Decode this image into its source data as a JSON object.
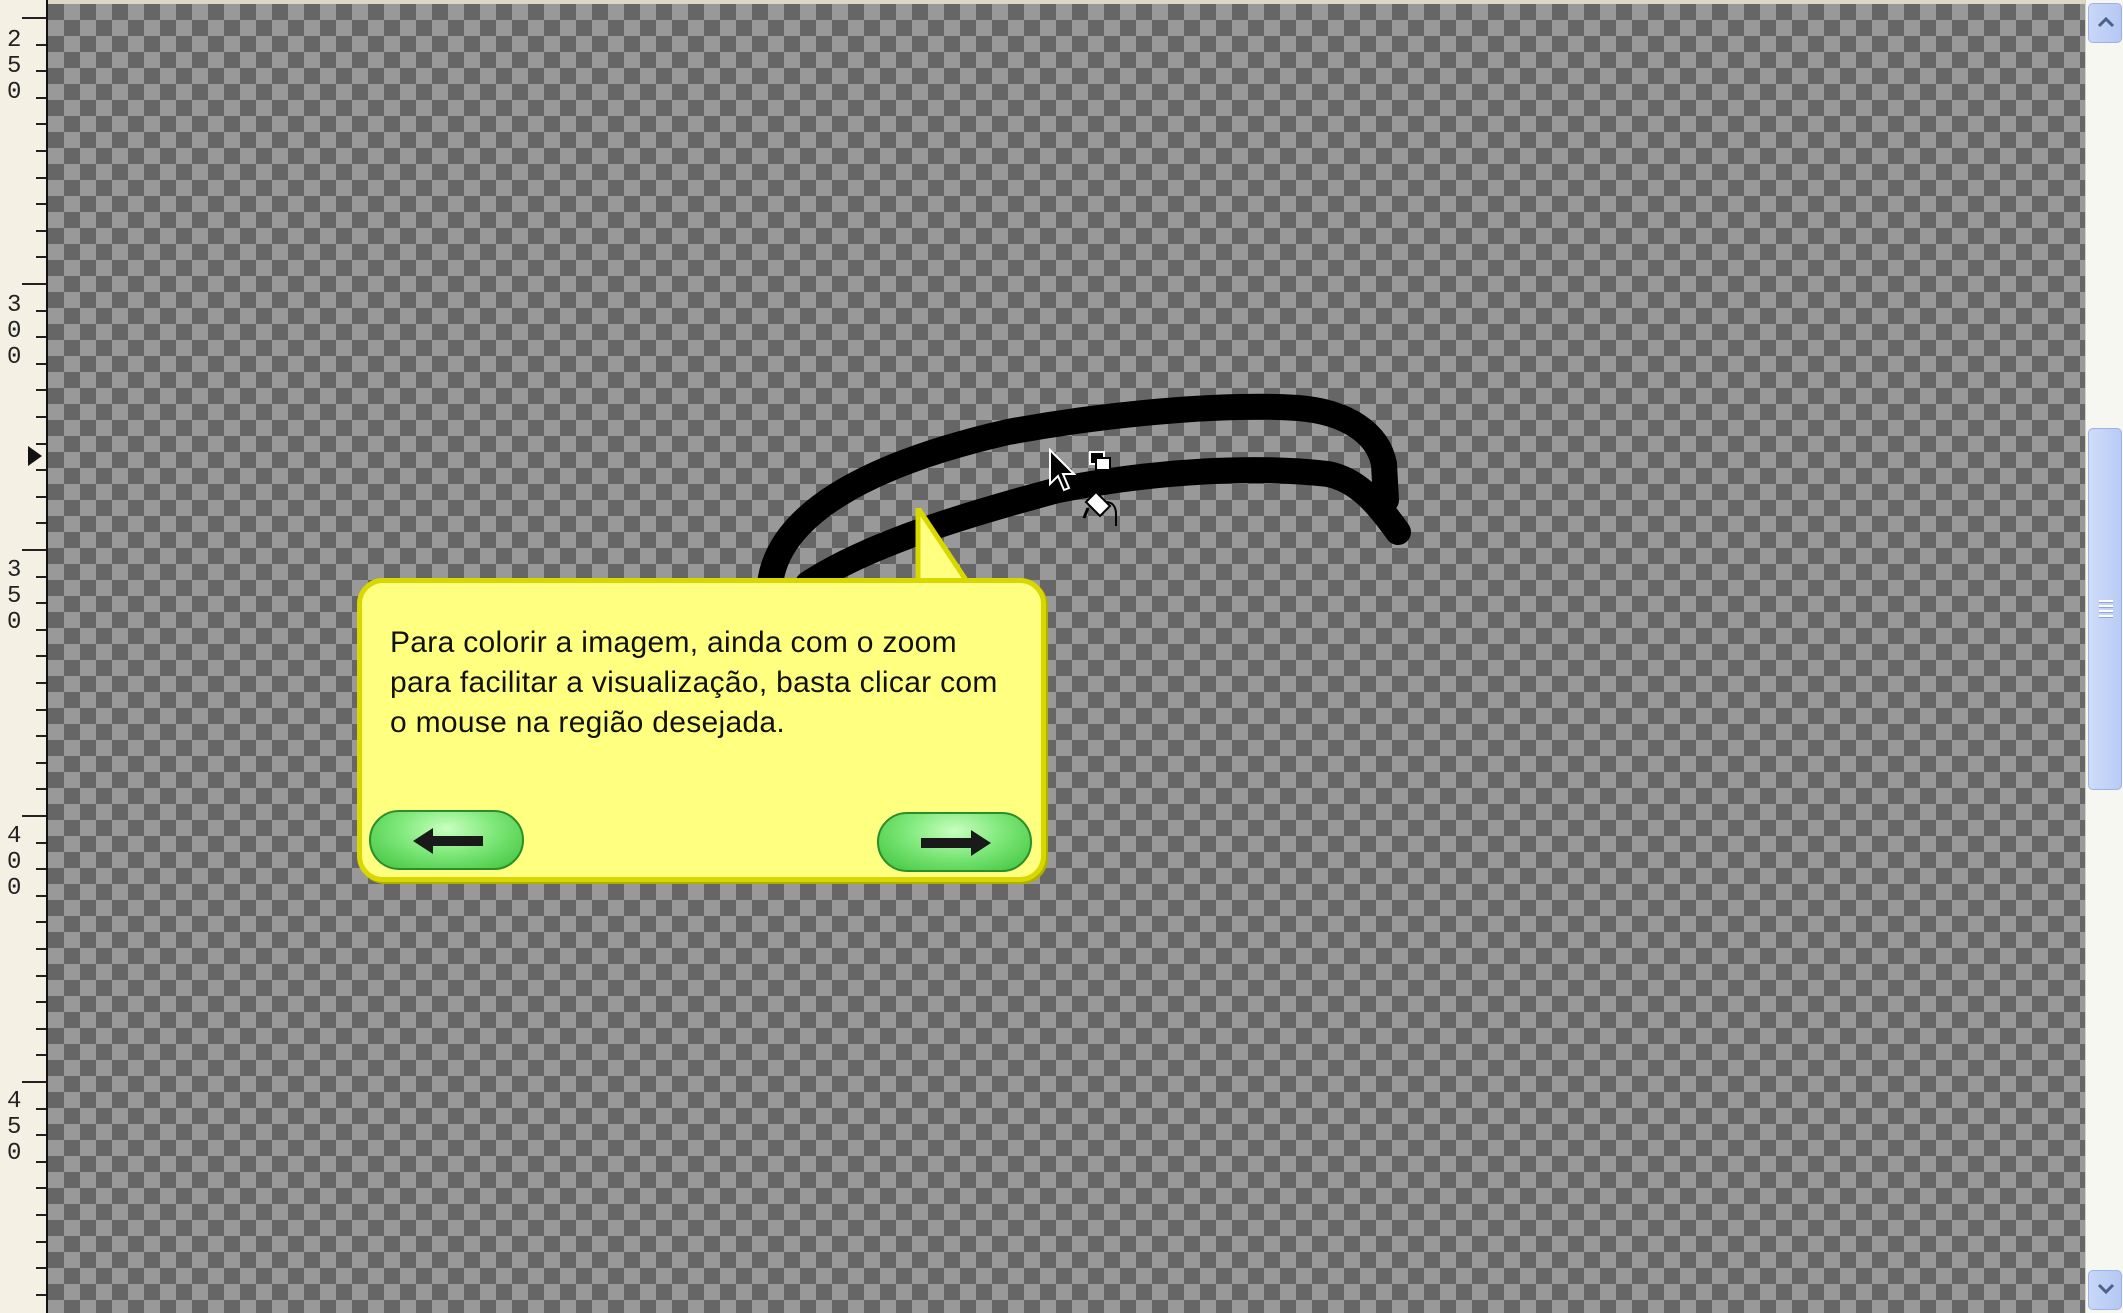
{
  "ruler": {
    "labels": [
      {
        "d1": "2",
        "d2": "5",
        "d3": "0"
      },
      {
        "d1": "3",
        "d2": "0",
        "d3": "0"
      },
      {
        "d1": "3",
        "d2": "5",
        "d3": "0"
      },
      {
        "d1": "4",
        "d2": "0",
        "d3": "0"
      },
      {
        "d1": "4",
        "d2": "5",
        "d3": "0"
      }
    ]
  },
  "callout": {
    "text": "Para colorir a imagem, ainda com o zoom para facilitar a visualização, basta clicar com o mouse na região desejada.",
    "prev_icon": "left-arrow-icon",
    "next_icon": "right-arrow-icon",
    "background_color": "#ffff80",
    "border_color": "#d8d800",
    "button_color": "#7fe87a"
  },
  "canvas": {
    "checker_dark": "#666666",
    "checker_light": "#999999"
  },
  "cursor": {
    "icon": "paint-bucket-cursor-icon"
  },
  "scrollbar": {
    "up_icon": "chevron-up-icon",
    "down_icon": "chevron-down-icon"
  }
}
